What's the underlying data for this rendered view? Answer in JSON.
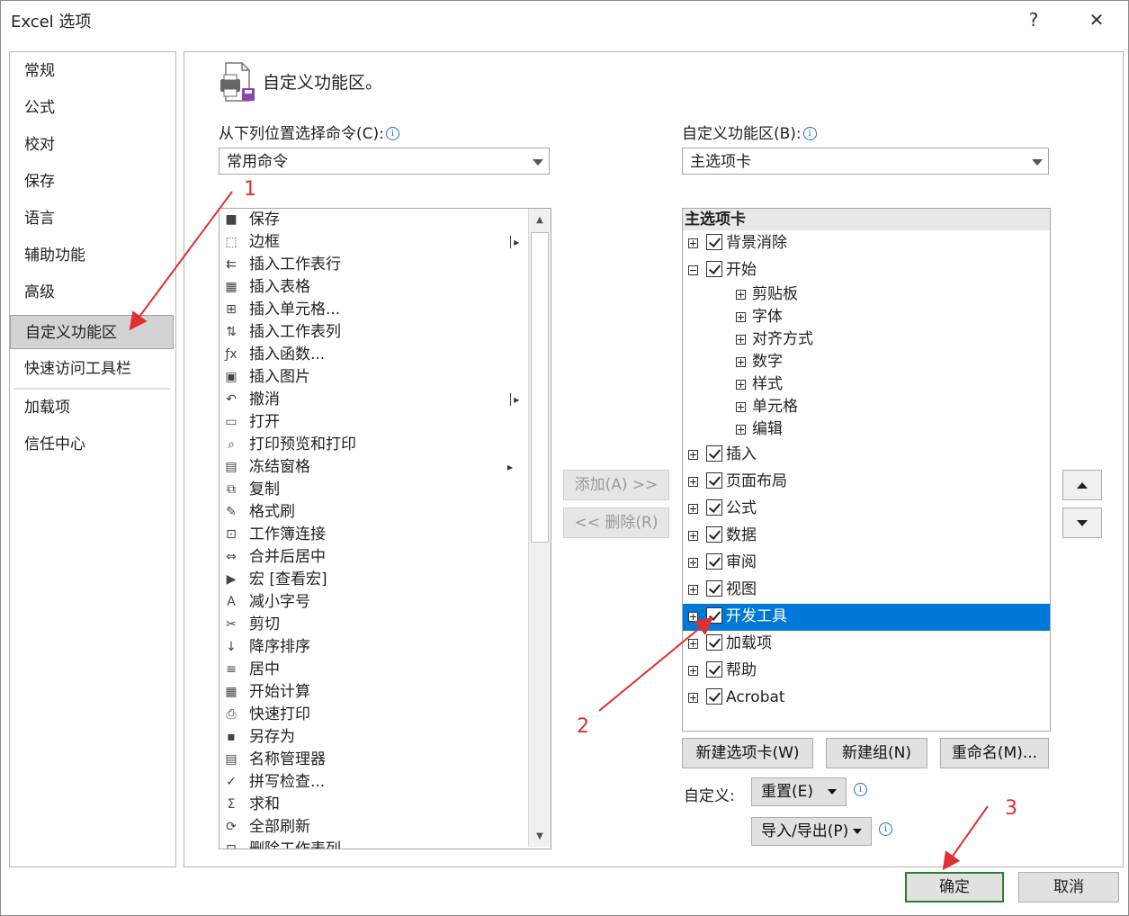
{
  "window": {
    "title": "Excel 选项",
    "help_glyph": "?",
    "close_glyph": "✕"
  },
  "sidebar": {
    "items": [
      {
        "label": "常规"
      },
      {
        "label": "公式"
      },
      {
        "label": "校对"
      },
      {
        "label": "保存"
      },
      {
        "label": "语言"
      },
      {
        "label": "辅助功能"
      },
      {
        "label": "高级"
      },
      {
        "label": "自定义功能区",
        "selected": true
      },
      {
        "label": "快速访问工具栏"
      },
      {
        "label": "加载项"
      },
      {
        "label": "信任中心"
      }
    ]
  },
  "section": {
    "title": "自定义功能区。",
    "icon": "customize-ribbon-icon"
  },
  "commands": {
    "label": "从下列位置选择命令(C):",
    "source_value": "常用命令",
    "items": [
      {
        "label": "保存",
        "icon": "save-icon",
        "glyph": "■"
      },
      {
        "label": "边框",
        "icon": "border-icon",
        "glyph": "⬚",
        "sub": "│▸"
      },
      {
        "label": "插入工作表行",
        "icon": "insert-rows-icon",
        "glyph": "⇇"
      },
      {
        "label": "插入表格",
        "icon": "insert-table-icon",
        "glyph": "▦"
      },
      {
        "label": "插入单元格...",
        "icon": "insert-cells-icon",
        "glyph": "⊞"
      },
      {
        "label": "插入工作表列",
        "icon": "insert-columns-icon",
        "glyph": "⇅"
      },
      {
        "label": "插入函数...",
        "icon": "function-icon",
        "glyph": "ƒx"
      },
      {
        "label": "插入图片",
        "icon": "picture-icon",
        "glyph": "▣"
      },
      {
        "label": "撤消",
        "icon": "undo-icon",
        "glyph": "↶",
        "sub": "│▸"
      },
      {
        "label": "打开",
        "icon": "open-folder-icon",
        "glyph": "▭"
      },
      {
        "label": "打印预览和打印",
        "icon": "print-preview-icon",
        "glyph": "⌕"
      },
      {
        "label": "冻结窗格",
        "icon": "freeze-panes-icon",
        "glyph": "▤",
        "sub": "▸"
      },
      {
        "label": "复制",
        "icon": "copy-icon",
        "glyph": "⧉"
      },
      {
        "label": "格式刷",
        "icon": "format-painter-icon",
        "glyph": "✎"
      },
      {
        "label": "工作簿连接",
        "icon": "connections-icon",
        "glyph": "⊡"
      },
      {
        "label": "合并后居中",
        "icon": "merge-center-icon",
        "glyph": "⇔"
      },
      {
        "label": "宏 [查看宏]",
        "icon": "macro-icon",
        "glyph": "▶"
      },
      {
        "label": "减小字号",
        "icon": "decrease-font-icon",
        "glyph": "A"
      },
      {
        "label": "剪切",
        "icon": "cut-icon",
        "glyph": "✂"
      },
      {
        "label": "降序排序",
        "icon": "sort-desc-icon",
        "glyph": "↓"
      },
      {
        "label": "居中",
        "icon": "align-center-icon",
        "glyph": "≡"
      },
      {
        "label": "开始计算",
        "icon": "calculator-icon",
        "glyph": "▦"
      },
      {
        "label": "快速打印",
        "icon": "quick-print-icon",
        "glyph": "⎙"
      },
      {
        "label": "另存为",
        "icon": "save-as-icon",
        "glyph": "▪"
      },
      {
        "label": "名称管理器",
        "icon": "name-manager-icon",
        "glyph": "▤"
      },
      {
        "label": "拼写检查...",
        "icon": "spelling-icon",
        "glyph": "✓"
      },
      {
        "label": "求和",
        "icon": "sum-icon",
        "glyph": "Σ"
      },
      {
        "label": "全部刷新",
        "icon": "refresh-all-icon",
        "glyph": "⟳"
      },
      {
        "label": "删除工作表列",
        "icon": "delete-columns-icon",
        "glyph": "⊟"
      }
    ]
  },
  "actions": {
    "add_label": "添加(A) >>",
    "remove_label": "<< 删除(R)"
  },
  "ribbon": {
    "label": "自定义功能区(B):",
    "scope_value": "主选项卡",
    "tree_header": "主选项卡",
    "tree": [
      {
        "label": "背景消除",
        "level": 0,
        "expander": "plus",
        "checked": true
      },
      {
        "label": "开始",
        "level": 0,
        "expander": "minus",
        "checked": true
      },
      {
        "label": "剪贴板",
        "level": 1,
        "expander": "plus"
      },
      {
        "label": "字体",
        "level": 1,
        "expander": "plus"
      },
      {
        "label": "对齐方式",
        "level": 1,
        "expander": "plus"
      },
      {
        "label": "数字",
        "level": 1,
        "expander": "plus"
      },
      {
        "label": "样式",
        "level": 1,
        "expander": "plus"
      },
      {
        "label": "单元格",
        "level": 1,
        "expander": "plus"
      },
      {
        "label": "编辑",
        "level": 1,
        "expander": "plus"
      },
      {
        "label": "插入",
        "level": 0,
        "expander": "plus",
        "checked": true
      },
      {
        "label": "页面布局",
        "level": 0,
        "expander": "plus",
        "checked": true
      },
      {
        "label": "公式",
        "level": 0,
        "expander": "plus",
        "checked": true
      },
      {
        "label": "数据",
        "level": 0,
        "expander": "plus",
        "checked": true
      },
      {
        "label": "审阅",
        "level": 0,
        "expander": "plus",
        "checked": true
      },
      {
        "label": "视图",
        "level": 0,
        "expander": "plus",
        "checked": true
      },
      {
        "label": "开发工具",
        "level": 0,
        "expander": "plus",
        "checked": true,
        "selected": true
      },
      {
        "label": "加载项",
        "level": 0,
        "expander": "plus",
        "checked": true
      },
      {
        "label": "帮助",
        "level": 0,
        "expander": "plus",
        "checked": true
      },
      {
        "label": "Acrobat",
        "level": 0,
        "expander": "plus",
        "checked": true
      }
    ],
    "new_tab_label": "新建选项卡(W)",
    "new_group_label": "新建组(N)",
    "rename_label": "重命名(M)...",
    "customize_label": "自定义:",
    "reset_label": "重置(E)",
    "import_export_label": "导入/导出(P)"
  },
  "footer": {
    "ok_label": "确定",
    "cancel_label": "取消"
  },
  "annotations": [
    "1",
    "2",
    "3"
  ],
  "colors": {
    "selection": "#0078d7",
    "annotation": "#e03030",
    "ok_border": "#2f7d32"
  }
}
